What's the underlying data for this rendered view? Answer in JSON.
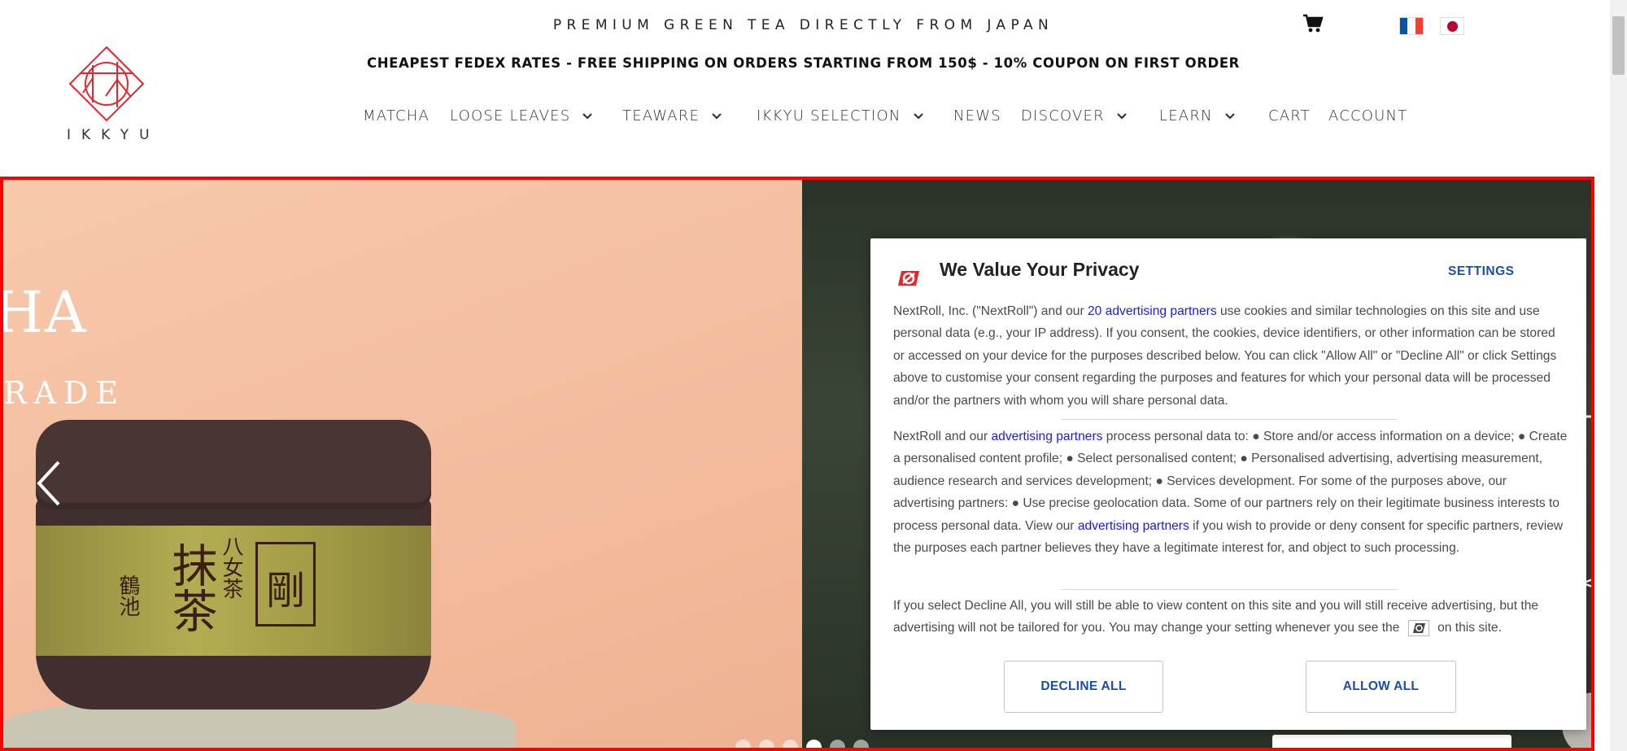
{
  "header": {
    "tagline": "PREMIUM GREEN TEA DIRECTLY FROM JAPAN",
    "shipping_banner": "CHEAPEST FEDEX RATES - FREE SHIPPING ON ORDERS STARTING FROM 150$ - 10% COUPON ON FIRST ORDER",
    "logo_text": "IKKYU",
    "cart_icon": "shopping-cart-icon",
    "languages": [
      "French",
      "Japanese"
    ]
  },
  "nav": {
    "items": [
      {
        "label": "MATCHA",
        "dropdown": false
      },
      {
        "label": "LOOSE LEAVES",
        "dropdown": true
      },
      {
        "label": "TEAWARE",
        "dropdown": true
      },
      {
        "label": "IKKYU SELECTION",
        "dropdown": true
      },
      {
        "label": "NEWS",
        "dropdown": false
      },
      {
        "label": "DISCOVER",
        "dropdown": true
      },
      {
        "label": "LEARN",
        "dropdown": true
      },
      {
        "label": "CART",
        "dropdown": false
      },
      {
        "label": "ACCOUNT",
        "dropdown": false
      }
    ]
  },
  "hero": {
    "title_fragment": "HA",
    "subtitle_fragment": "RADE",
    "tin_label_main": "抹茶",
    "tin_label_side": "八女茶",
    "tin_label_box": "剛",
    "tin_label_small": "鶴池",
    "slides_count": 6,
    "active_slide": 4
  },
  "privacy": {
    "title": "We Value Your Privacy",
    "settings_label": "SETTINGS",
    "p1_before": "NextRoll, Inc. (\"NextRoll\") and our ",
    "p1_link": "20 advertising partners",
    "p1_after": " use cookies and similar technologies on this site and use personal data (e.g., your IP address). If you consent, the cookies, device identifiers, or other information can be stored or accessed on your device for the purposes described below. You can click \"Allow All\" or \"Decline All\" or click Settings above to customise your consent regarding the purposes and features for which your personal data will be processed and/or the partners with whom you will share personal data.",
    "p2_before": "NextRoll and our ",
    "p2_link": "advertising partners",
    "p2_middle": " process personal data to: ● Store and/or access information on a device; ● Create a personalised content profile; ● Select personalised content; ● Personalised advertising, advertising measurement, audience research and services development; ● Services development. For some of the purposes above, our advertising partners: ● Use precise geolocation data. Some of our partners rely on their legitimate business interests to process personal data. View our ",
    "p2_link2": "advertising partners",
    "p2_after": " if you wish to provide or deny consent for specific partners, review the purposes each partner believes they have a legitimate interest for, and object to such processing.",
    "p3_before": "If you select Decline All, you will still be able to view content on this site and you will still receive advertising, but the advertising will not be tailored for you. You may change your setting whenever you see the ",
    "p3_after": " on this site.",
    "decline_label": "DECLINE ALL",
    "allow_label": "ALLOW ALL"
  },
  "colors": {
    "brand_red": "#e4262d",
    "link_blue": "#1a1ae6",
    "button_blue": "#1a4fa8",
    "hero_border": "#ff0000"
  }
}
